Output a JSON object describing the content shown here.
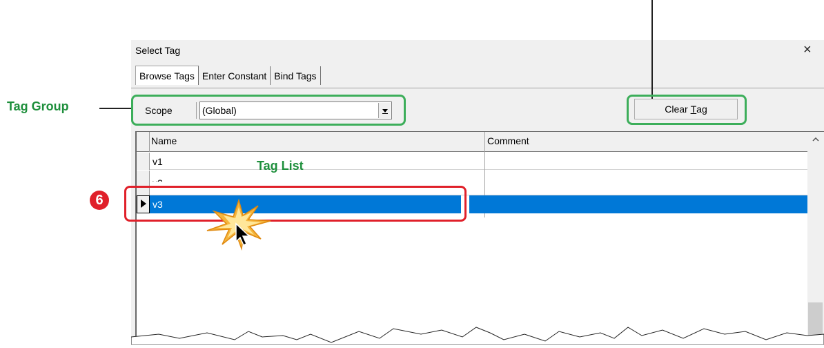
{
  "dialog": {
    "title": "Select Tag",
    "close_glyph": "×"
  },
  "tabs": [
    {
      "label": "Browse Tags",
      "active": true
    },
    {
      "label": "Enter Constant",
      "active": false
    },
    {
      "label": "Bind Tags",
      "active": false
    }
  ],
  "toolbar": {
    "scope_label": "Scope",
    "scope_value": "(Global)",
    "clear_prefix": "Clear ",
    "clear_mnemonic": "T",
    "clear_suffix": "ag"
  },
  "grid": {
    "columns": [
      "Name",
      "Comment"
    ],
    "rows": [
      {
        "name": "v1",
        "comment": ""
      },
      {
        "name": "v2",
        "comment": ""
      },
      {
        "name": "v3",
        "comment": "",
        "selected": true
      }
    ]
  },
  "annotations": {
    "tag_group": "Tag Group",
    "tag_list": "Tag List",
    "step_badge": "6"
  },
  "colors": {
    "selection": "#0078d7",
    "annotation_green": "#3cae5a",
    "annotation_red": "#e0202a",
    "dialog_bg": "#f0f0f0"
  },
  "icons": [
    "close-icon",
    "dropdown-arrow-icon",
    "row-pointer-icon",
    "scroll-up-icon",
    "mouse-cursor-icon",
    "click-burst-icon"
  ]
}
